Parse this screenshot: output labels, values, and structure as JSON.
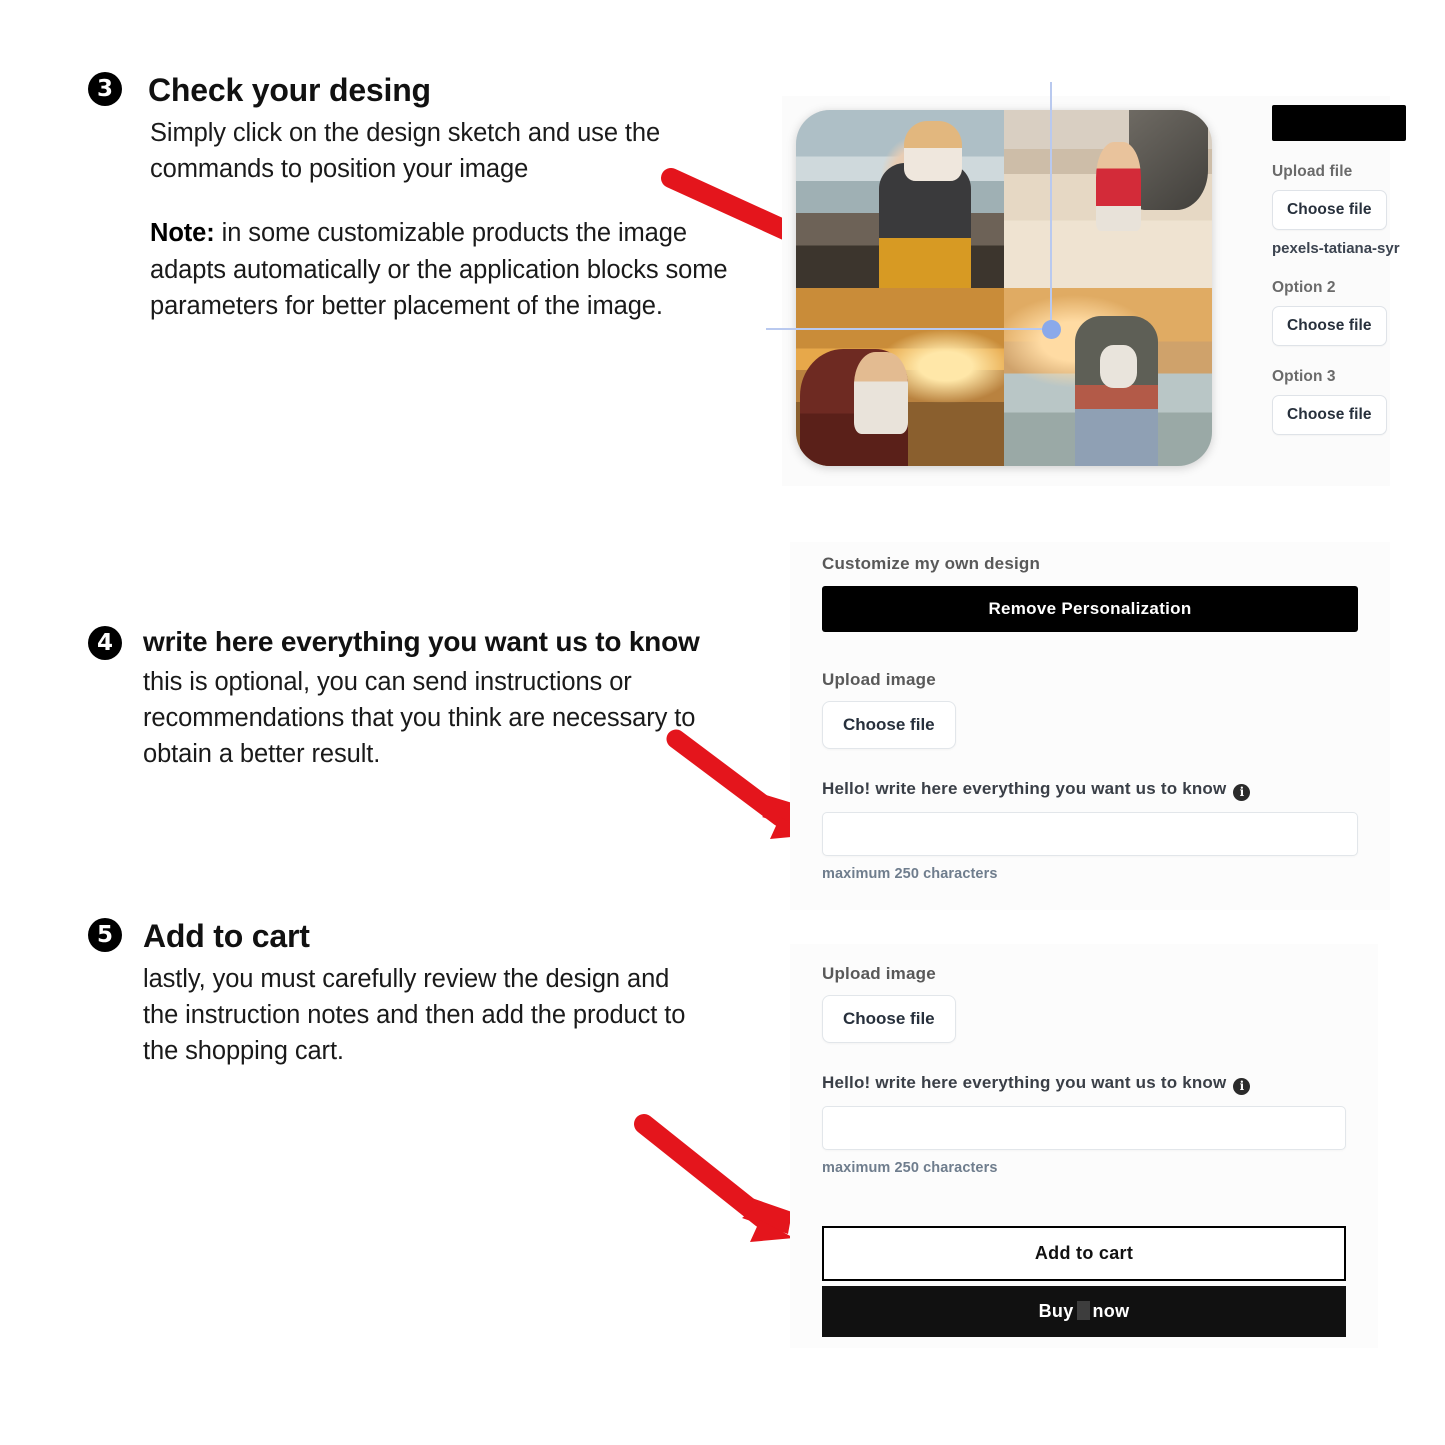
{
  "steps": [
    {
      "number": "3",
      "title": "Check your desing",
      "paragraph1": "Simply click on the design sketch and use the commands to position your image",
      "note_label": "Note:",
      "note_rest": " in some customizable products the image adapts automatically or the application blocks some parameters for better placement of the image."
    },
    {
      "number": "4",
      "title": "write here everything you want us to know",
      "paragraph1": "this is optional, you can send instructions or recommendations that you think are necessary to obtain a better result."
    },
    {
      "number": "5",
      "title": "Add to cart",
      "paragraph1": "lastly, you must carefully review the design and the instruction notes and then  add the product to the shopping cart."
    }
  ],
  "preview": {
    "photos": [
      "father-carrying-baby-on-shoulders-at-beach",
      "mother-with-baby-on-blanket-at-beach",
      "grandmother-kissing-baby-at-sunset",
      "family-couple-holding-baby-at-shore"
    ],
    "guide_color": "#b9c9ef",
    "handle_color": "#8aa9ea"
  },
  "options_column": {
    "upload_file_label": "Upload file",
    "choose_file_label": "Choose file",
    "selected_filename": "pexels-tatiana-syr",
    "option2_label": "Option 2",
    "option2_choose_label": "Choose file",
    "option3_label": "Option 3",
    "option3_choose_label": "Choose file"
  },
  "form_panel_1": {
    "customize_label": "Customize my own design",
    "remove_personalization_label": "Remove Personalization",
    "upload_image_label": "Upload image",
    "choose_file_label": "Choose file",
    "message_label": "Hello! write here everything you want us to know",
    "message_value": "",
    "message_hint": "maximum 250 characters",
    "info_icon_glyph": "i"
  },
  "form_panel_2": {
    "upload_image_label": "Upload image",
    "choose_file_label": "Choose file",
    "message_label": "Hello! write here everything you want us to know",
    "message_value": "",
    "message_hint": "maximum 250 characters",
    "info_icon_glyph": "i",
    "add_to_cart_label": "Add to cart",
    "buy_now_prefix": "Buy",
    "buy_now_suffix": "now"
  },
  "colors": {
    "arrow_red": "#e4151c",
    "cta_black": "#000000",
    "label_gray": "#595959",
    "hint_blue_gray": "#6f7d8d",
    "panel_bg": "#fcfcfc"
  }
}
